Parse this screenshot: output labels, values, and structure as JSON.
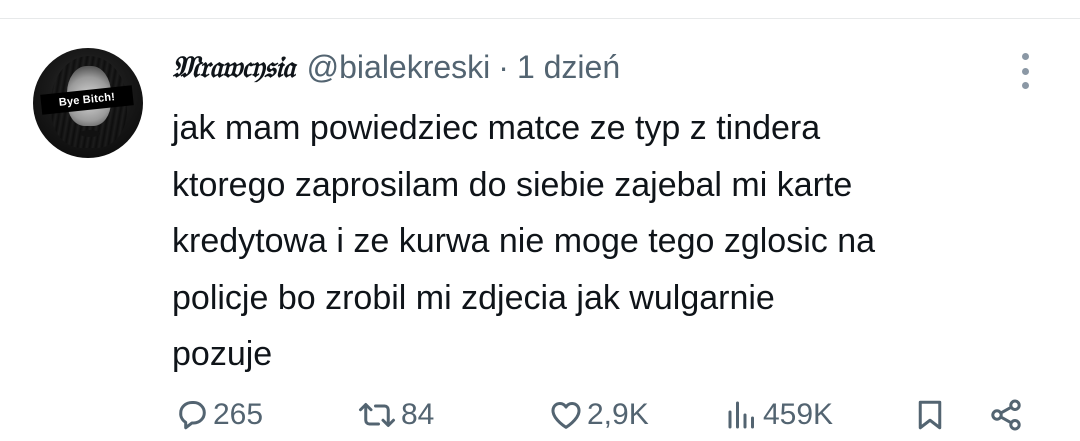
{
  "tweet": {
    "author": {
      "display_name": "𝔐𝔯𝔞𝔴𝔠𝔶𝔰𝔦𝔞",
      "handle": "@bialekreski",
      "avatar_caption": "Bye Bitch!"
    },
    "separator": "·",
    "time": "1 dzień",
    "text": "jak mam powiedziec matce ze typ z tindera\nktorego zaprosilam do siebie zajebal mi karte\nkredytowa i ze kurwa nie moge tego zglosic na\npolicje bo zrobil mi zdjecia jak wulgarnie\npozuje",
    "stats": {
      "replies": "265",
      "retweets": "84",
      "likes": "2,9K",
      "views": "459K"
    }
  },
  "icons": {
    "more": "more-vertical-icon",
    "reply": "reply-icon",
    "retweet": "retweet-icon",
    "like": "heart-icon",
    "views": "views-icon",
    "bookmark": "bookmark-icon",
    "share": "share-icon"
  },
  "colors": {
    "text_primary": "#0f1419",
    "text_secondary": "#536471",
    "divider": "#e7e9ea",
    "more_dots": "#8b98a5"
  }
}
